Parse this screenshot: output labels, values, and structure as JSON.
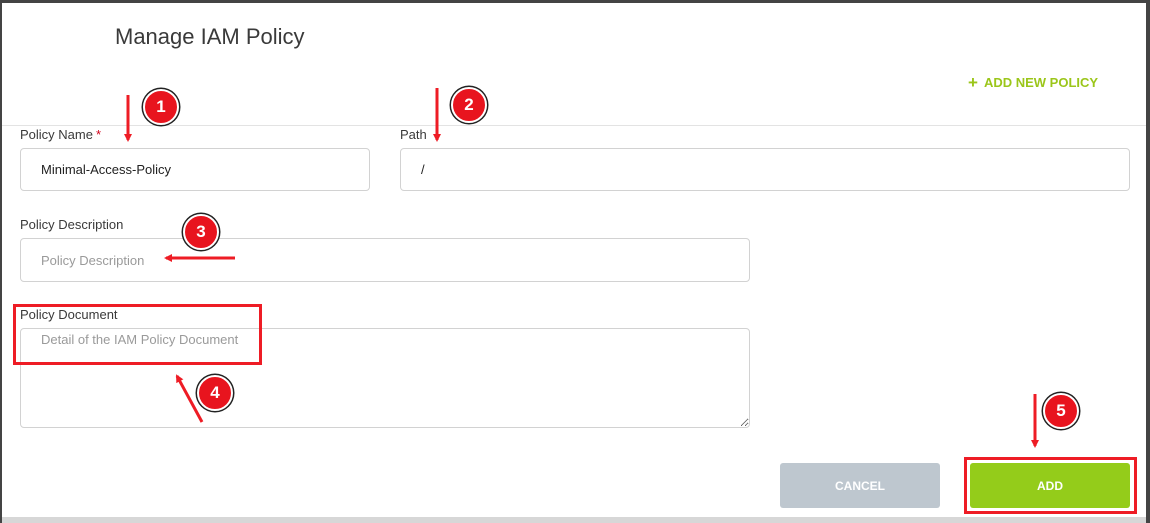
{
  "header": {
    "title": "Manage IAM Policy",
    "add_new_label": "ADD NEW POLICY",
    "add_new_icon": "plus-icon"
  },
  "form": {
    "policy_name": {
      "label": "Policy Name",
      "required_mark": "*",
      "value": "Minimal-Access-Policy"
    },
    "path": {
      "label": "Path",
      "value": "/"
    },
    "policy_description": {
      "label": "Policy Description",
      "placeholder": "Policy Description",
      "value": ""
    },
    "policy_document": {
      "label": "Policy Document",
      "placeholder": "Detail of the IAM Policy Document",
      "value": ""
    }
  },
  "actions": {
    "cancel_label": "CANCEL",
    "add_label": "ADD"
  },
  "annotations": [
    "1",
    "2",
    "3",
    "4",
    "5"
  ],
  "colors": {
    "accent_green": "#94cc1a",
    "link_green": "#9bc61a",
    "cancel_gray": "#bec7cf",
    "annotation_red": "#e8141e",
    "required_red": "#d0021b"
  }
}
